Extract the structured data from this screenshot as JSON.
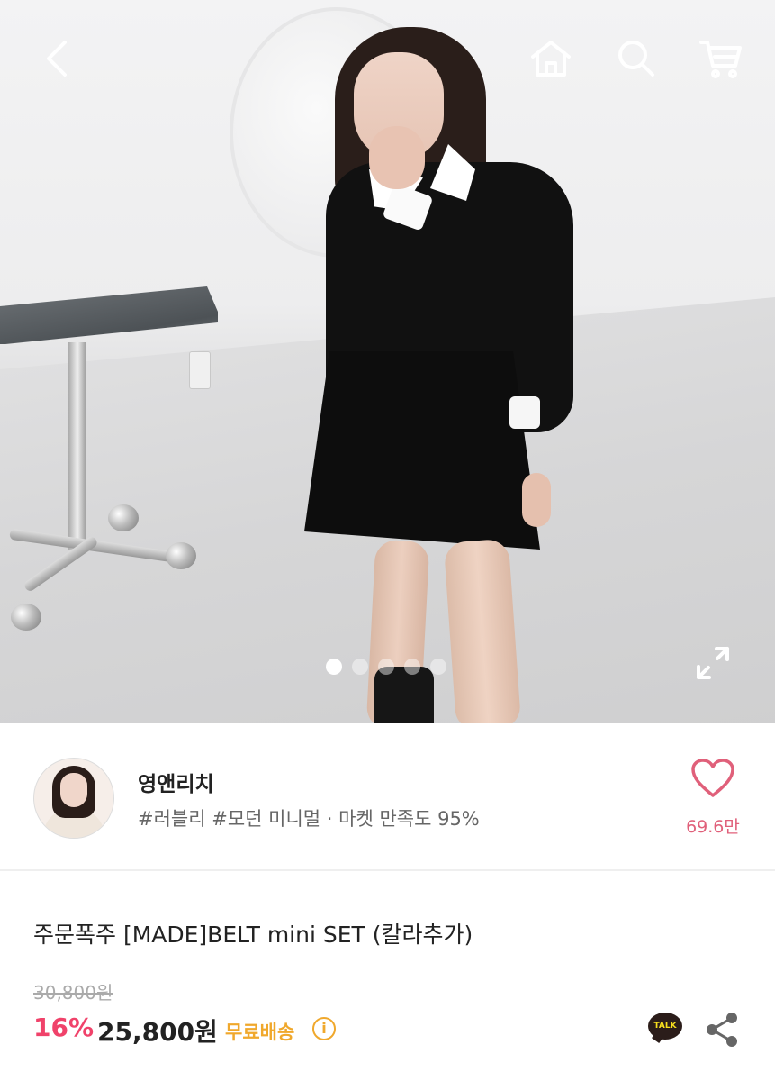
{
  "header": {
    "back_icon": "chevron-left-icon",
    "home_icon": "home-icon",
    "search_icon": "search-icon",
    "cart_icon": "cart-icon"
  },
  "gallery": {
    "total_slides": 5,
    "active_slide": 1,
    "expand_icon": "expand-icon"
  },
  "seller": {
    "name": "영앤리치",
    "tags": "#러블리 #모던 미니멀 · 마켓 만족도 95%",
    "likes": "69.6만",
    "heart_color": "#e0607a"
  },
  "product": {
    "title": "주문폭주 [MADE]BELT mini SET (칼라추가)",
    "original_price": "30,800원",
    "discount": "16%",
    "price": "25,800원",
    "shipping": "무료배송",
    "info_icon_text": "i",
    "talk_label": "TALK"
  },
  "colors": {
    "discount": "#f0426a",
    "shipping": "#f0a82c",
    "kakao_yellow": "#f7df1e",
    "kakao_brown": "#2b1d1a"
  }
}
